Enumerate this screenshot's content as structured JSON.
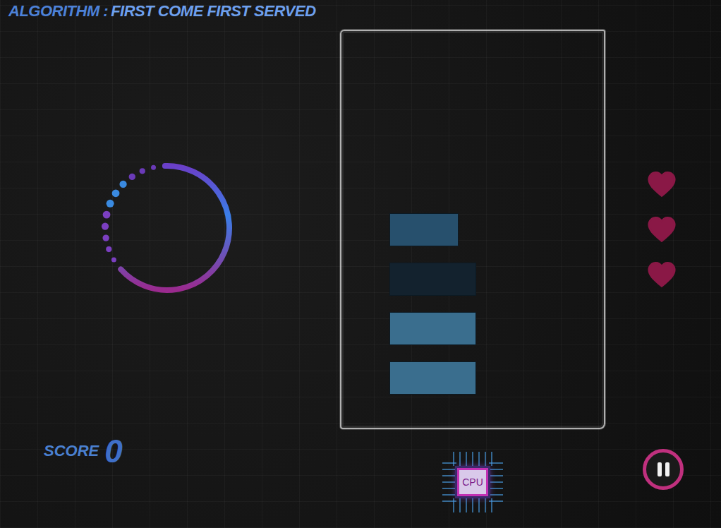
{
  "title": {
    "label": "ALGORITHM :",
    "value": "FIRST COME FIRST SERVED"
  },
  "timer": {
    "level": 0.64
  },
  "processes": [
    {
      "color": "#27506d",
      "level": 0.8
    },
    {
      "color": "#13222e",
      "level": 1
    },
    {
      "color": "#3a6e8e",
      "level": 1
    },
    {
      "color": "#3a6e8e",
      "level": 1
    }
  ],
  "lives": [
    {
      "filled": true
    },
    {
      "filled": true
    },
    {
      "filled": true
    }
  ],
  "score": {
    "label": "SCORE",
    "value": "0"
  },
  "cpu": {
    "label": "CPU"
  }
}
